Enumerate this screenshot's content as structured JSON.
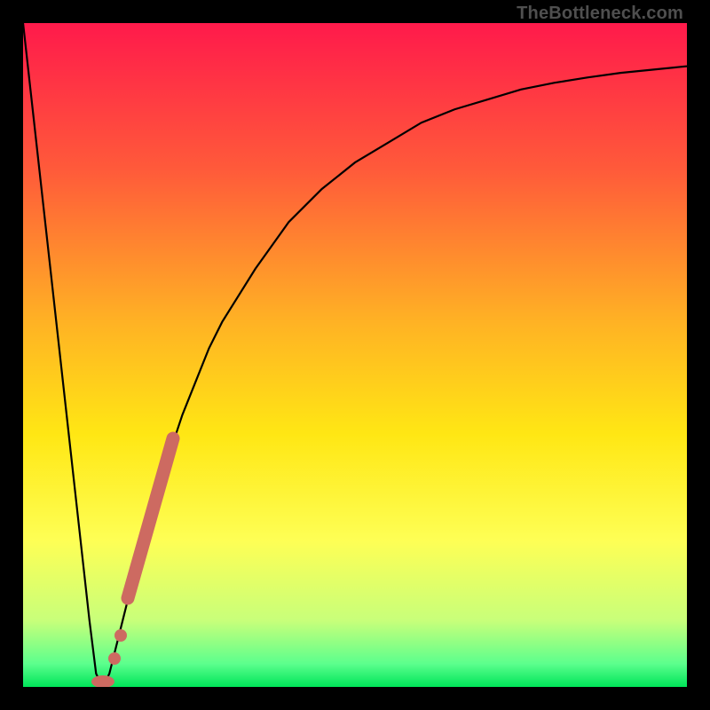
{
  "watermark": "TheBottleneck.com",
  "chart_data": {
    "type": "line",
    "title": "",
    "xlabel": "",
    "ylabel": "",
    "xlim": [
      0,
      100
    ],
    "ylim": [
      0,
      100
    ],
    "series": [
      {
        "name": "bottleneck-curve",
        "x": [
          0,
          2,
          4,
          6,
          8,
          10,
          11,
          12,
          13,
          14,
          15,
          16,
          18,
          20,
          22,
          24,
          26,
          28,
          30,
          35,
          40,
          45,
          50,
          55,
          60,
          65,
          70,
          75,
          80,
          85,
          90,
          95,
          100
        ],
        "values": [
          100,
          82,
          64,
          46,
          28,
          10,
          2,
          0,
          2,
          6,
          10,
          14,
          22,
          29,
          35,
          41,
          46,
          51,
          55,
          63,
          70,
          75,
          79,
          82,
          85,
          87,
          88.5,
          90,
          91,
          91.8,
          92.5,
          93,
          93.5
        ]
      }
    ],
    "highlight": {
      "name": "marker-segment",
      "x_range": [
        14.2,
        22.5
      ],
      "y_range": [
        4,
        41
      ],
      "color": "#cd6a61"
    },
    "background_gradient": {
      "stops": [
        {
          "offset": 0.0,
          "color": "#ff1a4b"
        },
        {
          "offset": 0.22,
          "color": "#ff5a3a"
        },
        {
          "offset": 0.45,
          "color": "#ffb224"
        },
        {
          "offset": 0.62,
          "color": "#ffe714"
        },
        {
          "offset": 0.78,
          "color": "#feff55"
        },
        {
          "offset": 0.9,
          "color": "#c8ff7a"
        },
        {
          "offset": 0.965,
          "color": "#5cff8d"
        },
        {
          "offset": 1.0,
          "color": "#00e559"
        }
      ]
    }
  }
}
